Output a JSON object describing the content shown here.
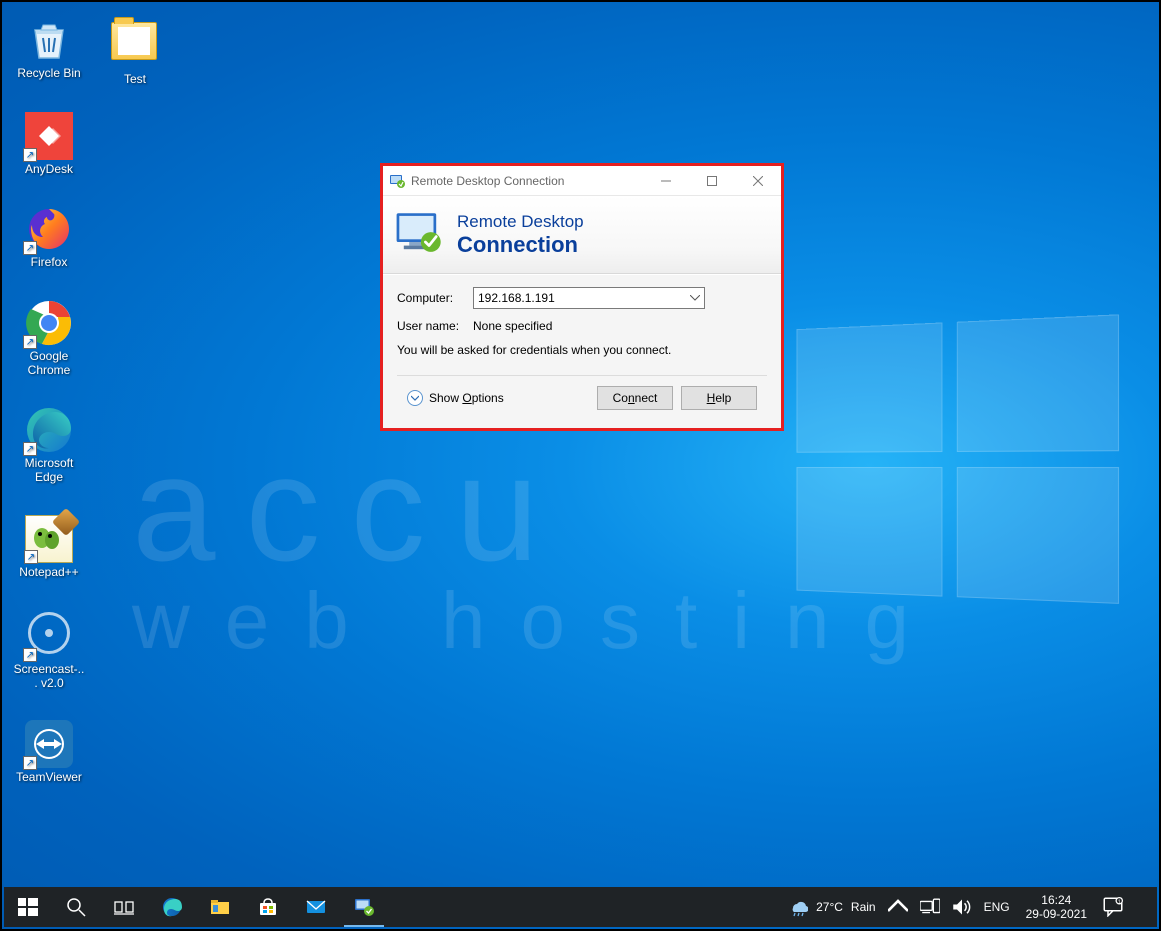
{
  "desktop_icons": {
    "recycle_bin": "Recycle Bin",
    "test_folder": "Test",
    "anydesk": "AnyDesk",
    "firefox": "Firefox",
    "chrome": "Google Chrome",
    "edge": "Microsoft Edge",
    "npp": "Notepad++",
    "screencast": "Screencast-... v2.0",
    "teamviewer": "TeamViewer"
  },
  "watermark": {
    "line1": "accu",
    "line2": "web hosting"
  },
  "dialog": {
    "title": "Remote Desktop Connection",
    "banner_line1": "Remote Desktop",
    "banner_line2": "Connection",
    "computer_label": "Computer:",
    "computer_value": "192.168.1.191",
    "username_label": "User name:",
    "username_value": "None specified",
    "note": "You will be asked for credentials when you connect.",
    "show_options_pre": "Show ",
    "show_options_u": "O",
    "show_options_post": "ptions",
    "connect_pre": "Co",
    "connect_u": "n",
    "connect_post": "nect",
    "help_pre": "",
    "help_u": "H",
    "help_post": "elp"
  },
  "taskbar": {
    "weather_temp": "27°C",
    "weather_desc": "Rain",
    "lang": "ENG",
    "time": "16:24",
    "date": "29-09-2021"
  }
}
